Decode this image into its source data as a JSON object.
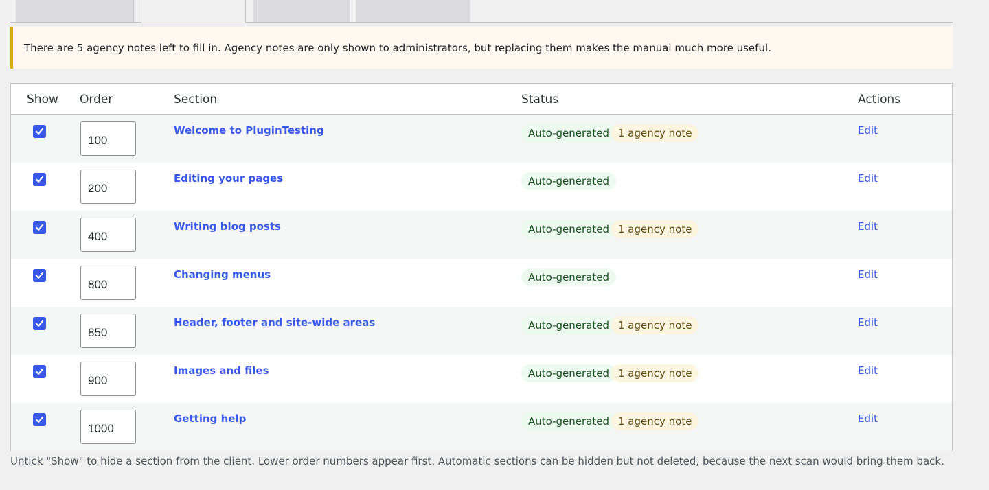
{
  "notice": {
    "text": "There are 5 agency notes left to fill in. Agency notes are only shown to administrators, but replacing them makes the manual much more useful."
  },
  "table": {
    "headers": {
      "show": "Show",
      "order": "Order",
      "section": "Section",
      "status": "Status",
      "actions": "Actions"
    },
    "rows": [
      {
        "checked": true,
        "order": "100",
        "section": "Welcome to PluginTesting",
        "status": "Auto-generated",
        "note": "1 agency note",
        "action": "Edit"
      },
      {
        "checked": true,
        "order": "200",
        "section": "Editing your pages",
        "status": "Auto-generated",
        "note": "",
        "action": "Edit"
      },
      {
        "checked": true,
        "order": "400",
        "section": "Writing blog posts",
        "status": "Auto-generated",
        "note": "1 agency note",
        "action": "Edit"
      },
      {
        "checked": true,
        "order": "800",
        "section": "Changing menus",
        "status": "Auto-generated",
        "note": "",
        "action": "Edit"
      },
      {
        "checked": true,
        "order": "850",
        "section": "Header, footer and site-wide areas",
        "status": "Auto-generated",
        "note": "1 agency note",
        "action": "Edit"
      },
      {
        "checked": true,
        "order": "900",
        "section": "Images and files",
        "status": "Auto-generated",
        "note": "1 agency note",
        "action": "Edit"
      },
      {
        "checked": true,
        "order": "1000",
        "section": "Getting help",
        "status": "Auto-generated",
        "note": "1 agency note",
        "action": "Edit"
      }
    ]
  },
  "footnote": "Untick \"Show\" to hide a section from the client. Lower order numbers appear first. Automatic sections can be hidden but not deleted, because the next scan would bring them back.",
  "colors": {
    "accent": "#3858e9",
    "notice_border": "#dba617",
    "notice_bg": "#fff8f0",
    "badge_auto_bg": "#edfaef",
    "badge_note_bg": "#fcf5e0"
  }
}
